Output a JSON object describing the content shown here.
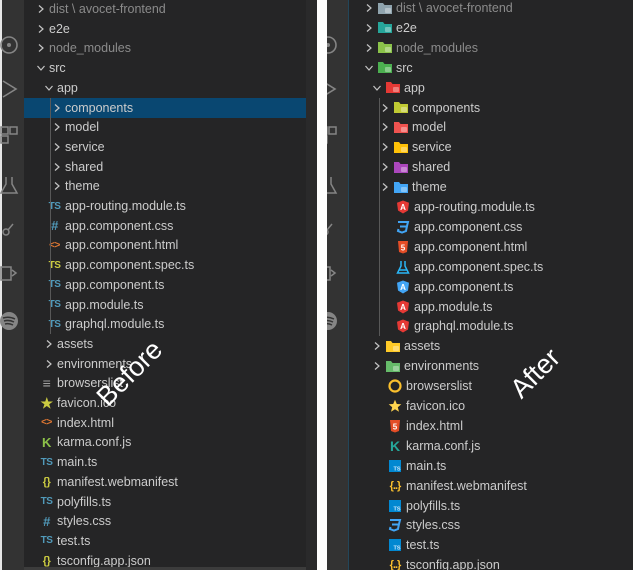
{
  "colors": {
    "selection": "#094771",
    "text": "#cccccc",
    "dim_text": "#8b8b8b",
    "explorer_bg": "#252526",
    "activity_bar_bg": "#333333"
  },
  "activity_bar_icons": [
    "debug-icon",
    "run-icon",
    "extensions-icon",
    "testing-icon",
    "source-control-icon",
    "remote-explorer-icon",
    "spotify-icon"
  ],
  "panels": [
    {
      "caption": "Before",
      "rows": [
        {
          "label": "dist \\ avocet-frontend",
          "depth": 0,
          "kind": "folder",
          "open": false,
          "dim": true,
          "icon": "none"
        },
        {
          "label": "e2e",
          "depth": 0,
          "kind": "folder",
          "open": false,
          "icon": "none"
        },
        {
          "label": "node_modules",
          "depth": 0,
          "kind": "folder",
          "open": false,
          "dim": true,
          "icon": "none"
        },
        {
          "label": "src",
          "depth": 0,
          "kind": "folder",
          "open": true,
          "icon": "none"
        },
        {
          "label": "app",
          "depth": 1,
          "kind": "folder",
          "open": true,
          "icon": "none"
        },
        {
          "label": "components",
          "depth": 2,
          "kind": "folder",
          "open": false,
          "selected": true,
          "icon": "none"
        },
        {
          "label": "model",
          "depth": 2,
          "kind": "folder",
          "open": false,
          "icon": "none"
        },
        {
          "label": "service",
          "depth": 2,
          "kind": "folder",
          "open": false,
          "icon": "none"
        },
        {
          "label": "shared",
          "depth": 2,
          "kind": "folder",
          "open": false,
          "icon": "none"
        },
        {
          "label": "theme",
          "depth": 2,
          "kind": "folder",
          "open": false,
          "icon": "none"
        },
        {
          "label": "app-routing.module.ts",
          "depth": 2,
          "kind": "file",
          "icon": "typescript-icon",
          "color": "#519aba"
        },
        {
          "label": "app.component.css",
          "depth": 2,
          "kind": "file",
          "icon": "css-hash-icon",
          "color": "#519aba"
        },
        {
          "label": "app.component.html",
          "depth": 2,
          "kind": "file",
          "icon": "html-brackets-icon",
          "color": "#e37933"
        },
        {
          "label": "app.component.spec.ts",
          "depth": 2,
          "kind": "file",
          "icon": "typescript-icon",
          "color": "#cbcb41"
        },
        {
          "label": "app.component.ts",
          "depth": 2,
          "kind": "file",
          "icon": "typescript-icon",
          "color": "#519aba"
        },
        {
          "label": "app.module.ts",
          "depth": 2,
          "kind": "file",
          "icon": "typescript-icon",
          "color": "#519aba"
        },
        {
          "label": "graphql.module.ts",
          "depth": 2,
          "kind": "file",
          "icon": "typescript-icon",
          "color": "#519aba"
        },
        {
          "label": "assets",
          "depth": 1,
          "kind": "folder",
          "open": false,
          "icon": "none"
        },
        {
          "label": "environments",
          "depth": 1,
          "kind": "folder",
          "open": false,
          "icon": "none"
        },
        {
          "label": "browserslist",
          "depth": 1,
          "kind": "file",
          "icon": "lines-icon",
          "color": "#a0a0a0"
        },
        {
          "label": "favicon.ico",
          "depth": 1,
          "kind": "file",
          "icon": "star-icon",
          "color": "#cbcb41"
        },
        {
          "label": "index.html",
          "depth": 1,
          "kind": "file",
          "icon": "html-brackets-icon",
          "color": "#e37933"
        },
        {
          "label": "karma.conf.js",
          "depth": 1,
          "kind": "file",
          "icon": "karma-icon",
          "color": "#8dc149"
        },
        {
          "label": "main.ts",
          "depth": 1,
          "kind": "file",
          "icon": "typescript-icon",
          "color": "#519aba"
        },
        {
          "label": "manifest.webmanifest",
          "depth": 1,
          "kind": "file",
          "icon": "json-braces-icon",
          "color": "#cbcb41"
        },
        {
          "label": "polyfills.ts",
          "depth": 1,
          "kind": "file",
          "icon": "typescript-icon",
          "color": "#519aba"
        },
        {
          "label": "styles.css",
          "depth": 1,
          "kind": "file",
          "icon": "css-hash-icon",
          "color": "#519aba"
        },
        {
          "label": "test.ts",
          "depth": 1,
          "kind": "file",
          "icon": "typescript-icon",
          "color": "#519aba"
        },
        {
          "label": "tsconfig.app.json",
          "depth": 1,
          "kind": "file",
          "icon": "json-braces-icon",
          "color": "#cbcb41"
        }
      ]
    },
    {
      "caption": "After",
      "rows": [
        {
          "label": "dist \\ avocet-frontend",
          "depth": 0,
          "kind": "folder",
          "open": false,
          "dim": true,
          "icon": "folder-dist-icon",
          "color": "#90a4ae"
        },
        {
          "label": "e2e",
          "depth": 0,
          "kind": "folder",
          "open": false,
          "icon": "folder-e2e-icon",
          "color": "#26a69a"
        },
        {
          "label": "node_modules",
          "depth": 0,
          "kind": "folder",
          "open": false,
          "dim": true,
          "icon": "folder-node-icon",
          "color": "#8bc34a"
        },
        {
          "label": "src",
          "depth": 0,
          "kind": "folder",
          "open": true,
          "icon": "folder-src-open-icon",
          "color": "#4caf50"
        },
        {
          "label": "app",
          "depth": 1,
          "kind": "folder",
          "open": true,
          "icon": "folder-app-open-icon",
          "color": "#e53935"
        },
        {
          "label": "components",
          "depth": 2,
          "kind": "folder",
          "open": false,
          "icon": "folder-components-icon",
          "color": "#c0ca33"
        },
        {
          "label": "model",
          "depth": 2,
          "kind": "folder",
          "open": false,
          "icon": "folder-model-icon",
          "color": "#ef5350"
        },
        {
          "label": "service",
          "depth": 2,
          "kind": "folder",
          "open": false,
          "icon": "folder-service-icon",
          "color": "#ffc107"
        },
        {
          "label": "shared",
          "depth": 2,
          "kind": "folder",
          "open": false,
          "icon": "folder-shared-icon",
          "color": "#ab47bc"
        },
        {
          "label": "theme",
          "depth": 2,
          "kind": "folder",
          "open": false,
          "icon": "folder-theme-icon",
          "color": "#42a5f5"
        },
        {
          "label": "app-routing.module.ts",
          "depth": 2,
          "kind": "file",
          "icon": "angular-icon",
          "color": "#e53935"
        },
        {
          "label": "app.component.css",
          "depth": 2,
          "kind": "file",
          "icon": "css3-icon",
          "color": "#42a5f5"
        },
        {
          "label": "app.component.html",
          "depth": 2,
          "kind": "file",
          "icon": "html5-icon",
          "color": "#e44d26"
        },
        {
          "label": "app.component.spec.ts",
          "depth": 2,
          "kind": "file",
          "icon": "flask-icon",
          "color": "#29b6f6"
        },
        {
          "label": "app.component.ts",
          "depth": 2,
          "kind": "file",
          "icon": "angular-icon",
          "color": "#42a5f5"
        },
        {
          "label": "app.module.ts",
          "depth": 2,
          "kind": "file",
          "icon": "angular-icon",
          "color": "#e53935"
        },
        {
          "label": "graphql.module.ts",
          "depth": 2,
          "kind": "file",
          "icon": "angular-icon",
          "color": "#e53935"
        },
        {
          "label": "assets",
          "depth": 1,
          "kind": "folder",
          "open": false,
          "icon": "folder-assets-icon",
          "color": "#ffca28"
        },
        {
          "label": "environments",
          "depth": 1,
          "kind": "folder",
          "open": false,
          "icon": "folder-environment-icon",
          "color": "#66bb6a"
        },
        {
          "label": "browserslist",
          "depth": 1,
          "kind": "file",
          "icon": "browserslist-icon",
          "color": "#fbc02d"
        },
        {
          "label": "favicon.ico",
          "depth": 1,
          "kind": "file",
          "icon": "star-icon",
          "color": "#ffd54f"
        },
        {
          "label": "index.html",
          "depth": 1,
          "kind": "file",
          "icon": "html5-icon",
          "color": "#e44d26"
        },
        {
          "label": "karma.conf.js",
          "depth": 1,
          "kind": "file",
          "icon": "karma-icon",
          "color": "#26a69a"
        },
        {
          "label": "main.ts",
          "depth": 1,
          "kind": "file",
          "icon": "typescript-box-icon",
          "color": "#0288d1"
        },
        {
          "label": "manifest.webmanifest",
          "depth": 1,
          "kind": "file",
          "icon": "json-braces-icon",
          "color": "#fbc02d"
        },
        {
          "label": "polyfills.ts",
          "depth": 1,
          "kind": "file",
          "icon": "typescript-box-icon",
          "color": "#0288d1"
        },
        {
          "label": "styles.css",
          "depth": 1,
          "kind": "file",
          "icon": "css3-icon",
          "color": "#42a5f5"
        },
        {
          "label": "test.ts",
          "depth": 1,
          "kind": "file",
          "icon": "typescript-box-icon",
          "color": "#0288d1"
        },
        {
          "label": "tsconfig.app.json",
          "depth": 1,
          "kind": "file",
          "icon": "json-braces-icon",
          "color": "#fbc02d"
        }
      ]
    }
  ]
}
